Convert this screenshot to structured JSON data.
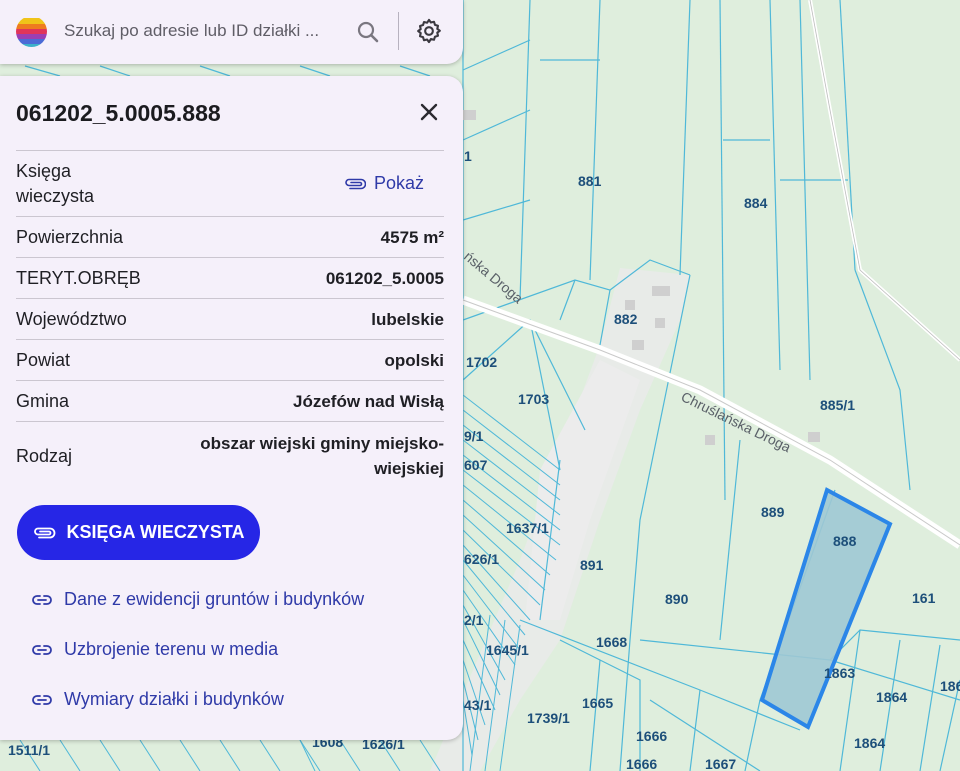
{
  "search": {
    "placeholder": "Szukaj po adresie lub ID działki ...",
    "value": ""
  },
  "panel": {
    "title": "061202_5.0005.888",
    "kw_row": {
      "label": "Księga\nwieczysta",
      "action": "Pokaż"
    },
    "rows": [
      {
        "label": "Powierzchnia",
        "value": "4575 m²"
      },
      {
        "label": "TERYT.OBRĘB",
        "value": "061202_5.0005"
      },
      {
        "label": "Województwo",
        "value": "lubelskie"
      },
      {
        "label": "Powiat",
        "value": "opolski"
      },
      {
        "label": "Gmina",
        "value": "Józefów nad Wisłą"
      },
      {
        "label": "Rodzaj",
        "value": "obszar wiejski gminy miejsko-wiejskiej"
      }
    ],
    "primary_button": "KSIĘGA WIECZYSTA",
    "links": [
      "Dane z ewidencji gruntów i budynków",
      "Uzbrojenie terenu w media",
      "Wymiary działki i budynków"
    ]
  },
  "map": {
    "road_name": "Chruślańska Droga",
    "road_name_partial": "ńska Droga",
    "selected_parcel": "888",
    "parcel_labels": [
      "881",
      "884",
      "882",
      "1702",
      "1703",
      "885/1",
      "889",
      "888",
      "891",
      "890",
      "161",
      "1637/1",
      "626/1",
      "1668",
      "1863",
      "1864",
      "1864",
      "1645/1",
      "1665",
      "1739/1",
      "1666",
      "1666",
      "1667",
      "43/1",
      "1511/1",
      "1608",
      "1626/1",
      "2/1",
      "9/1",
      "607",
      "1",
      "186"
    ]
  },
  "colors": {
    "map_background": "#dfeedd",
    "parcel_border": "#4fb8d8",
    "selected_fill": "#9fc8d4",
    "selected_border": "#2b86e8",
    "accent": "#2626e6",
    "link": "#2f3aa8",
    "panel_bg": "#f5f0fa"
  },
  "icons": [
    "logo-icon",
    "search-icon",
    "gear-icon",
    "close-icon",
    "paperclip-icon",
    "link-icon"
  ]
}
